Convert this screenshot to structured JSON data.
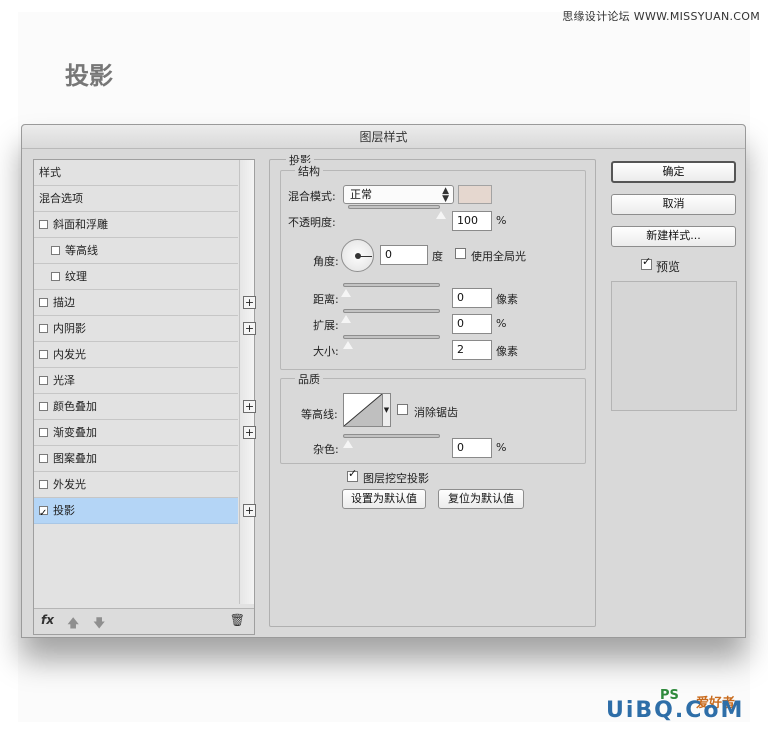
{
  "site_watermark": "思缘设计论坛 WWW.MISSYUAN.COM",
  "page_heading": "投影",
  "dialog": {
    "title": "图层样式",
    "sidebar": {
      "items": [
        {
          "label": "样式",
          "checkbox": false,
          "checked": false,
          "plus": false,
          "indent": 0,
          "selected": false
        },
        {
          "label": "混合选项",
          "checkbox": false,
          "checked": false,
          "plus": false,
          "indent": 0,
          "selected": false
        },
        {
          "label": "斜面和浮雕",
          "checkbox": true,
          "checked": false,
          "plus": false,
          "indent": 0,
          "selected": false
        },
        {
          "label": "等高线",
          "checkbox": true,
          "checked": false,
          "plus": false,
          "indent": 1,
          "selected": false
        },
        {
          "label": "纹理",
          "checkbox": true,
          "checked": false,
          "plus": false,
          "indent": 1,
          "selected": false
        },
        {
          "label": "描边",
          "checkbox": true,
          "checked": false,
          "plus": true,
          "indent": 0,
          "selected": false
        },
        {
          "label": "内阴影",
          "checkbox": true,
          "checked": false,
          "plus": true,
          "indent": 0,
          "selected": false
        },
        {
          "label": "内发光",
          "checkbox": true,
          "checked": false,
          "plus": false,
          "indent": 0,
          "selected": false
        },
        {
          "label": "光泽",
          "checkbox": true,
          "checked": false,
          "plus": false,
          "indent": 0,
          "selected": false
        },
        {
          "label": "颜色叠加",
          "checkbox": true,
          "checked": false,
          "plus": true,
          "indent": 0,
          "selected": false
        },
        {
          "label": "渐变叠加",
          "checkbox": true,
          "checked": false,
          "plus": true,
          "indent": 0,
          "selected": false
        },
        {
          "label": "图案叠加",
          "checkbox": true,
          "checked": false,
          "plus": false,
          "indent": 0,
          "selected": false
        },
        {
          "label": "外发光",
          "checkbox": true,
          "checked": false,
          "plus": false,
          "indent": 0,
          "selected": false
        },
        {
          "label": "投影",
          "checkbox": true,
          "checked": true,
          "plus": true,
          "indent": 0,
          "selected": true
        }
      ],
      "footer": {
        "fx": "fx",
        "up_icon": "arrow-up-icon",
        "down_icon": "arrow-down-icon",
        "trash_icon": "trash-icon"
      }
    },
    "drop_shadow": {
      "section_title": "投影",
      "structure": {
        "title": "结构",
        "blend_mode_label": "混合模式:",
        "blend_mode_value": "正常",
        "color": "#e5d7cf",
        "opacity_label": "不透明度:",
        "opacity_value": "100",
        "opacity_unit": "%",
        "opacity_fraction": 1.0,
        "angle_label": "角度:",
        "angle_value": "0",
        "angle_unit": "度",
        "global_light_label": "使用全局光",
        "global_light_checked": false,
        "distance_label": "距离:",
        "distance_value": "0",
        "distance_unit": "像素",
        "spread_label": "扩展:",
        "spread_value": "0",
        "spread_unit": "%",
        "size_label": "大小:",
        "size_value": "2",
        "size_unit": "像素"
      },
      "quality": {
        "title": "品质",
        "contour_label": "等高线:",
        "anti_alias_label": "消除锯齿",
        "anti_alias_checked": false,
        "noise_label": "杂色:",
        "noise_value": "0",
        "noise_unit": "%"
      },
      "knockout_label": "图层挖空投影",
      "knockout_checked": true,
      "make_default_label": "设置为默认值",
      "reset_default_label": "复位为默认值"
    },
    "buttons": {
      "ok": "确定",
      "cancel": "取消",
      "new_style": "新建样式...",
      "preview_label": "预览",
      "preview_checked": true
    }
  },
  "bottom_watermark": {
    "brand": "UiBQ.CoM",
    "ps": "PS",
    "site": "爱好者"
  }
}
